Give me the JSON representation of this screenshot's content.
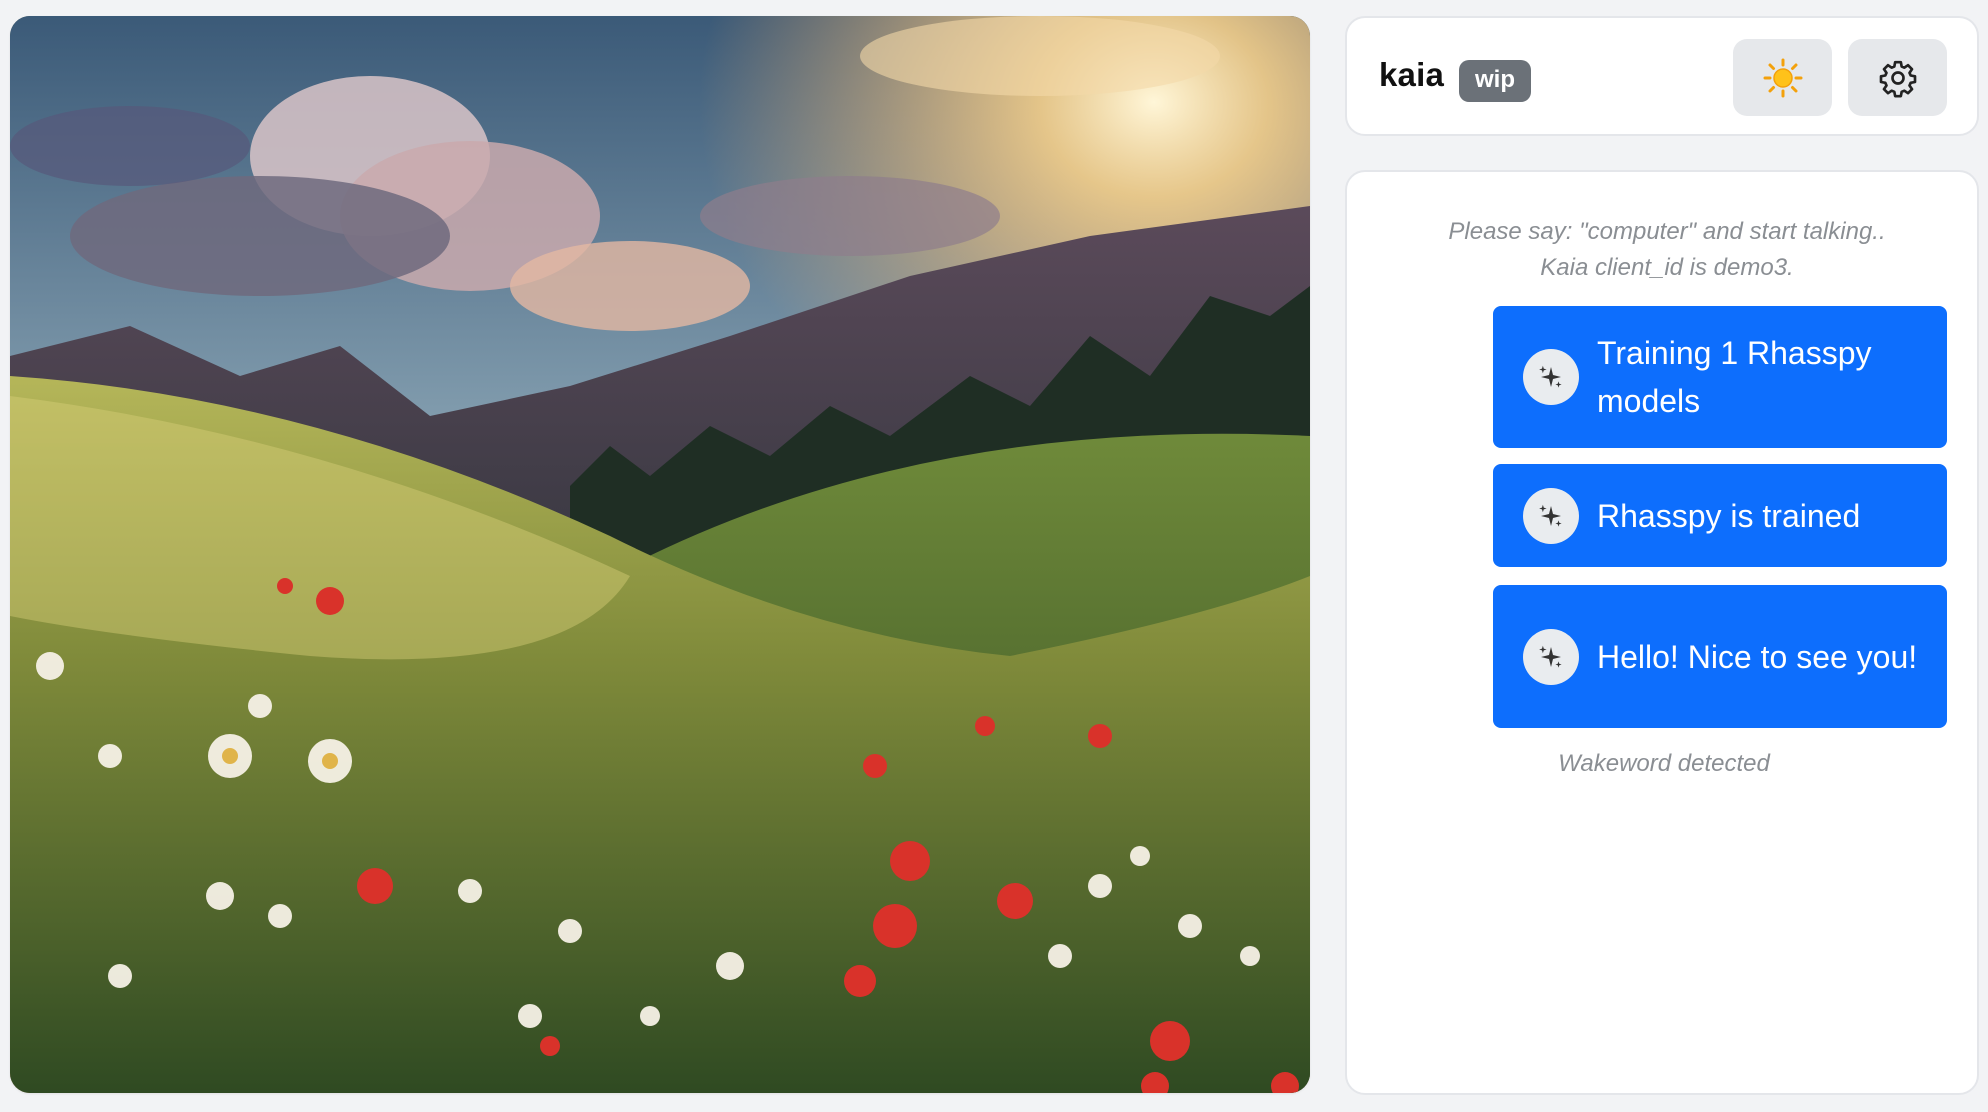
{
  "header": {
    "title": "kaia",
    "badge": "wip",
    "theme_icon": "sun-icon",
    "settings_icon": "gear-icon"
  },
  "chat": {
    "intro": "Please say: \"computer\" and start talking.. Kaia client_id is demo3.",
    "messages": [
      {
        "text": "Training 1 Rhasspy models",
        "icon": "sparkles-icon"
      },
      {
        "text": "Rhasspy is trained",
        "icon": "sparkles-icon"
      },
      {
        "text": "Hello! Nice to see you!",
        "icon": "sparkles-icon"
      }
    ],
    "status": "Wakeword detected"
  },
  "colors": {
    "message_bubble": "#0d6efd",
    "badge": "#6b7178",
    "button_bg": "#e6e8eb"
  }
}
